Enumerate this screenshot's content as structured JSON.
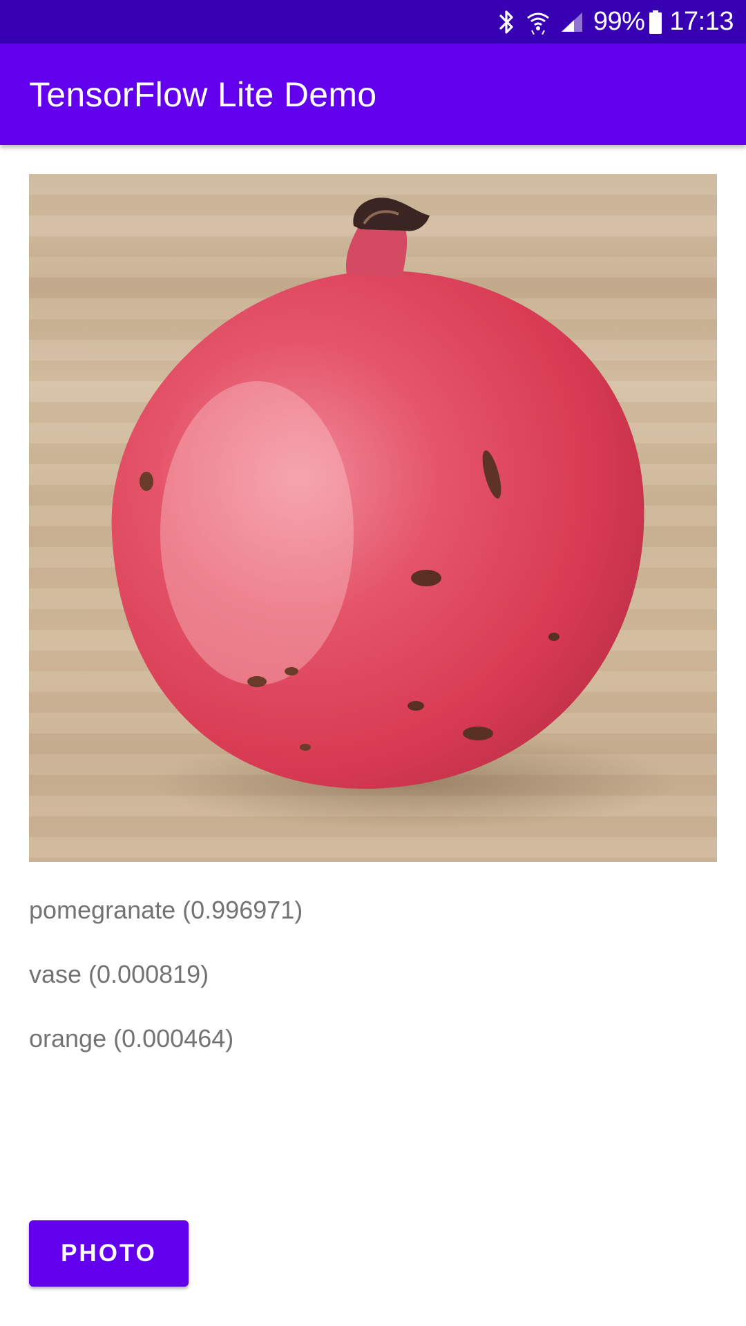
{
  "status_bar": {
    "battery_percent": "99%",
    "time": "17:13",
    "icons": [
      "bluetooth-icon",
      "wifi-icon",
      "cell-signal-icon",
      "battery-icon"
    ]
  },
  "app_bar": {
    "title": "TensorFlow Lite Demo"
  },
  "photo": {
    "subject": "pomegranate"
  },
  "results": [
    {
      "label": "pomegranate (0.996971)"
    },
    {
      "label": "vase (0.000819)"
    },
    {
      "label": "orange (0.000464)"
    }
  ],
  "button": {
    "label": "PHOTO"
  },
  "colors": {
    "status_bar": "#3700b3",
    "primary": "#6200ee",
    "result_text": "#737373"
  }
}
